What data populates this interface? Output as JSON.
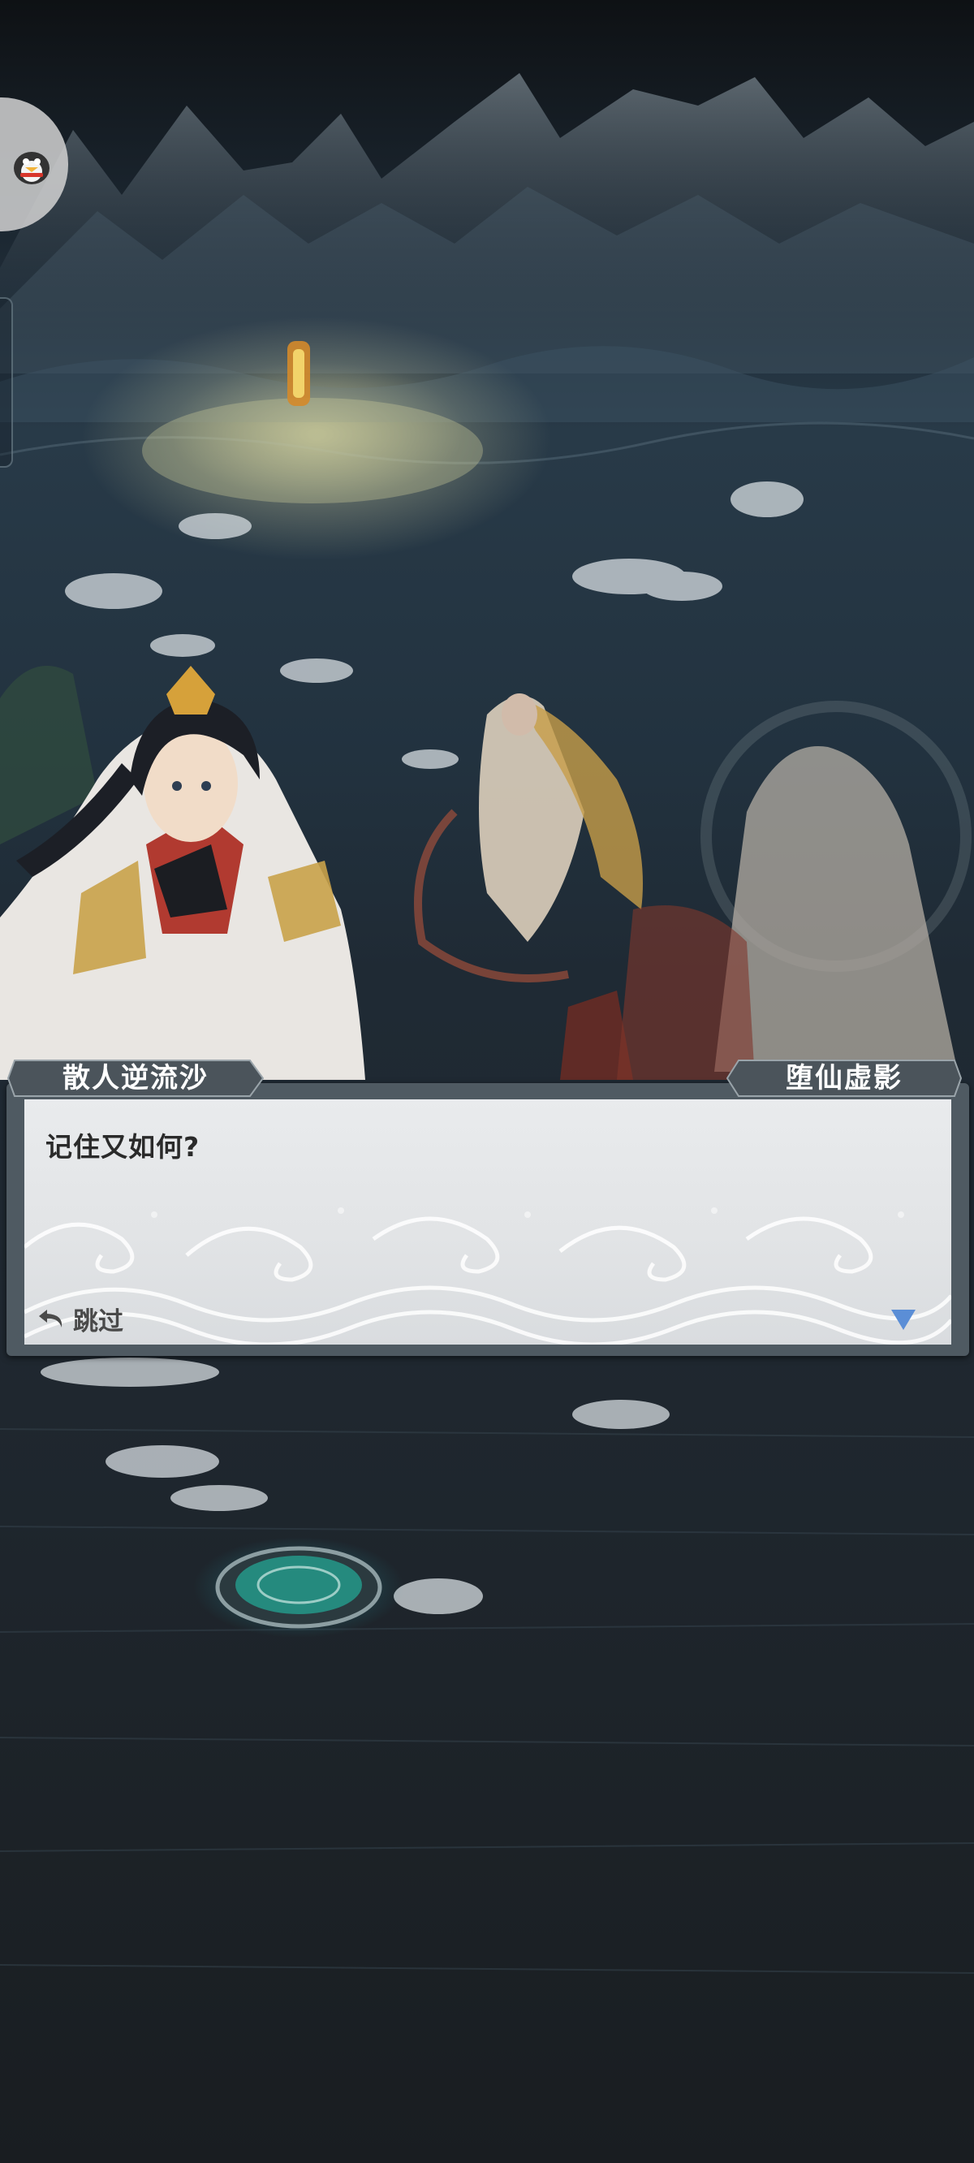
{
  "dialog": {
    "speaker_left": "散人逆流沙",
    "speaker_right": "堕仙虚影",
    "text": "记住又如何?",
    "skip_label": "跳过"
  },
  "icons": {
    "avatar": "penguin-avatar-icon",
    "skip": "undo-arrow-icon",
    "next": "triangle-down-icon"
  },
  "colors": {
    "dialog_frame": "#4f5a62",
    "dialog_panel": "#e4e6e8",
    "nameplate": "#4b545b",
    "next_indicator": "#5b8ed6"
  }
}
